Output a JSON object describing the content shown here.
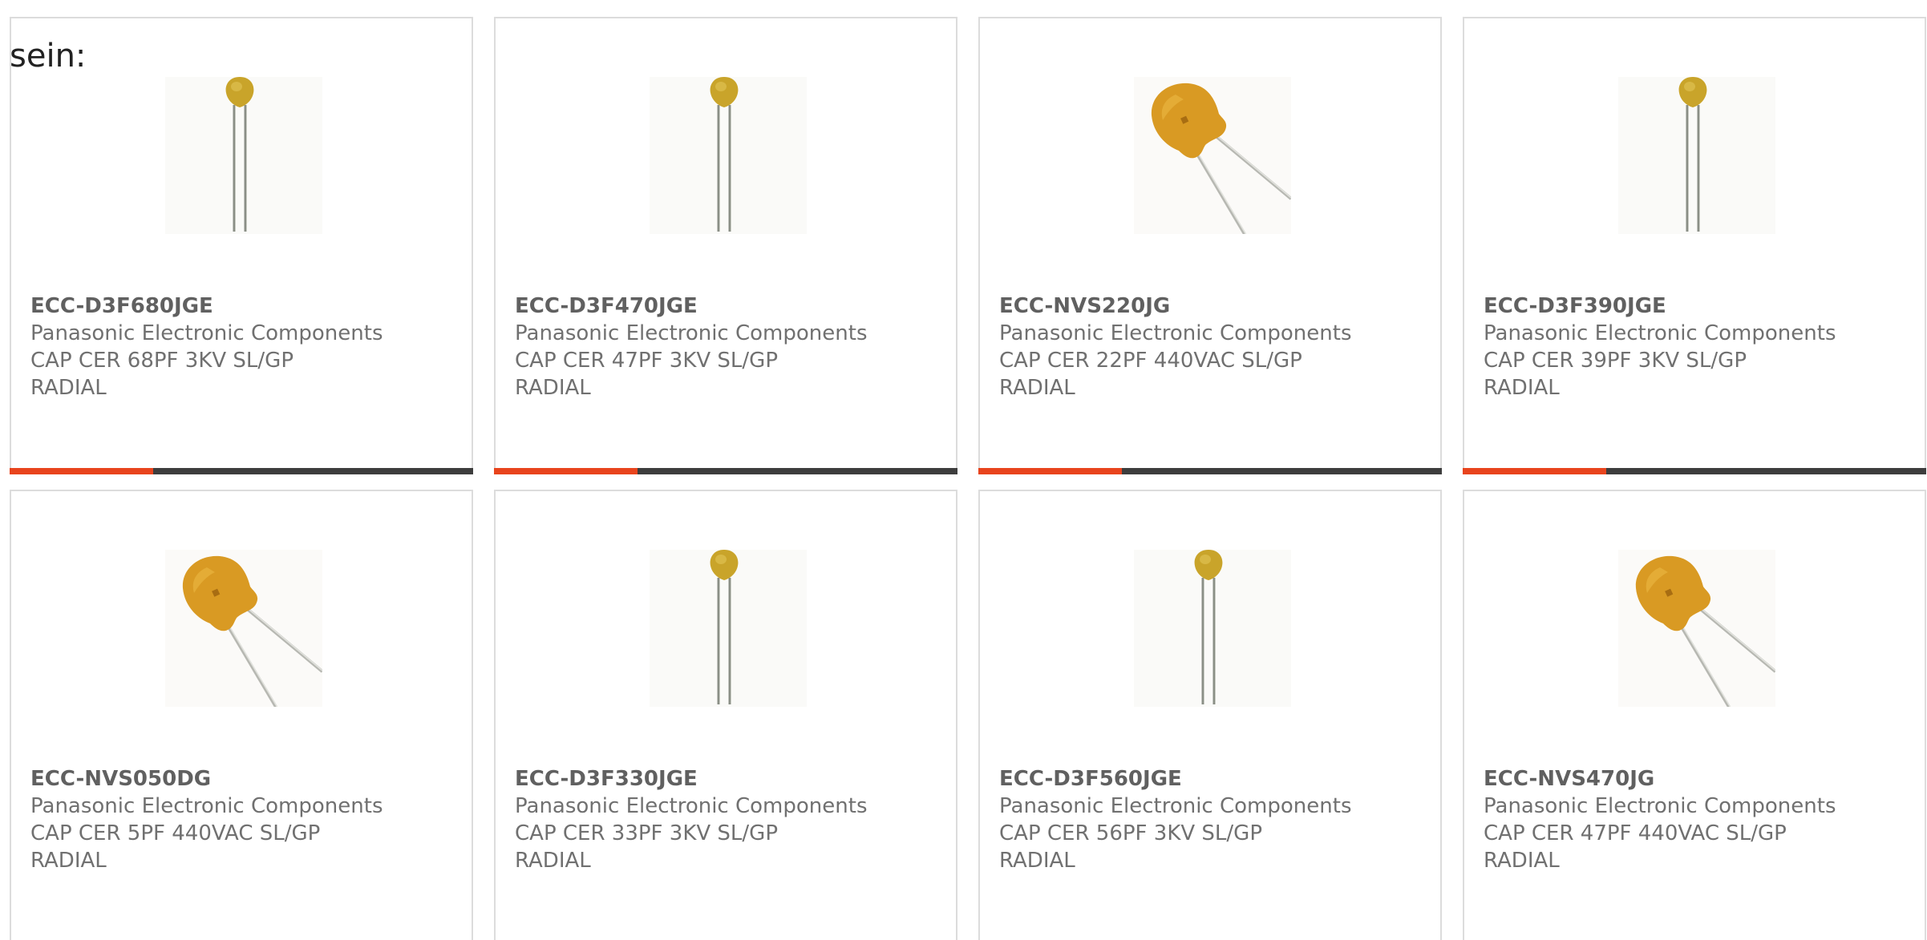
{
  "lead_text": "sein:",
  "colors": {
    "accent": "#e8441d",
    "track": "#3d3d3d",
    "card_border": "#dcdcdc"
  },
  "products": [
    {
      "part_number": "ECC-D3F680JGE",
      "manufacturer": "Panasonic Electronic Components",
      "desc1": "CAP CER 68PF 3KV SL/GP",
      "desc2": "RADIAL",
      "image_icon": "capacitor-small-disc-icon",
      "progress_fraction": 0.31
    },
    {
      "part_number": "ECC-D3F470JGE",
      "manufacturer": "Panasonic Electronic Components",
      "desc1": "CAP CER 47PF 3KV SL/GP",
      "desc2": "RADIAL",
      "image_icon": "capacitor-small-disc-icon",
      "progress_fraction": 0.31
    },
    {
      "part_number": "ECC-NVS220JG",
      "manufacturer": "Panasonic Electronic Components",
      "desc1": "CAP CER 22PF 440VAC SL/GP",
      "desc2": "RADIAL",
      "image_icon": "capacitor-large-disc-icon",
      "progress_fraction": 0.31
    },
    {
      "part_number": "ECC-D3F390JGE",
      "manufacturer": "Panasonic Electronic Components",
      "desc1": "CAP CER 39PF 3KV SL/GP",
      "desc2": "RADIAL",
      "image_icon": "capacitor-small-disc-icon",
      "progress_fraction": 0.31
    },
    {
      "part_number": "ECC-NVS050DG",
      "manufacturer": "Panasonic Electronic Components",
      "desc1": "CAP CER 5PF 440VAC SL/GP",
      "desc2": "RADIAL",
      "image_icon": "capacitor-large-disc-icon"
    },
    {
      "part_number": "ECC-D3F330JGE",
      "manufacturer": "Panasonic Electronic Components",
      "desc1": "CAP CER 33PF 3KV SL/GP",
      "desc2": "RADIAL",
      "image_icon": "capacitor-small-disc-icon"
    },
    {
      "part_number": "ECC-D3F560JGE",
      "manufacturer": "Panasonic Electronic Components",
      "desc1": "CAP CER 56PF 3KV SL/GP",
      "desc2": "RADIAL",
      "image_icon": "capacitor-small-disc-icon"
    },
    {
      "part_number": "ECC-NVS470JG",
      "manufacturer": "Panasonic Electronic Components",
      "desc1": "CAP CER 47PF 440VAC SL/GP",
      "desc2": "RADIAL",
      "image_icon": "capacitor-large-disc-icon"
    }
  ]
}
